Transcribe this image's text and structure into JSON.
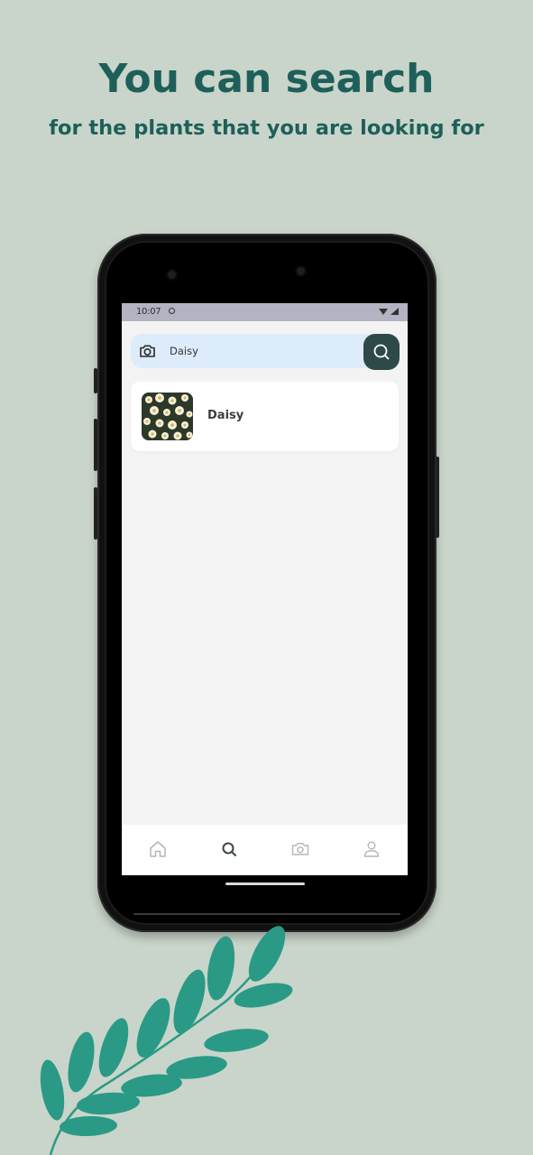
{
  "promo": {
    "headline": "You can search",
    "subline": "for the plants that you are looking for"
  },
  "status_bar": {
    "time": "10:07"
  },
  "search": {
    "value": "Daisy",
    "camera_icon": "camera-icon",
    "search_icon": "search-icon"
  },
  "results": [
    {
      "name": "Daisy",
      "thumbnail": "daisy-thumbnail"
    }
  ],
  "bottom_nav": {
    "items": [
      {
        "icon": "home-icon",
        "active": false
      },
      {
        "icon": "search-icon",
        "active": true
      },
      {
        "icon": "camera-icon",
        "active": false
      },
      {
        "icon": "profile-icon",
        "active": false
      }
    ]
  },
  "colors": {
    "page_background": "#c9d5ca",
    "headline": "#1e5f59",
    "search_bar": "#ddecfb",
    "search_button": "#2d4a49",
    "screen_background": "#f3f3f3",
    "leaf": "#2a9a86",
    "nav_active": "#3a4646",
    "nav_inactive": "#b5b5b5"
  }
}
